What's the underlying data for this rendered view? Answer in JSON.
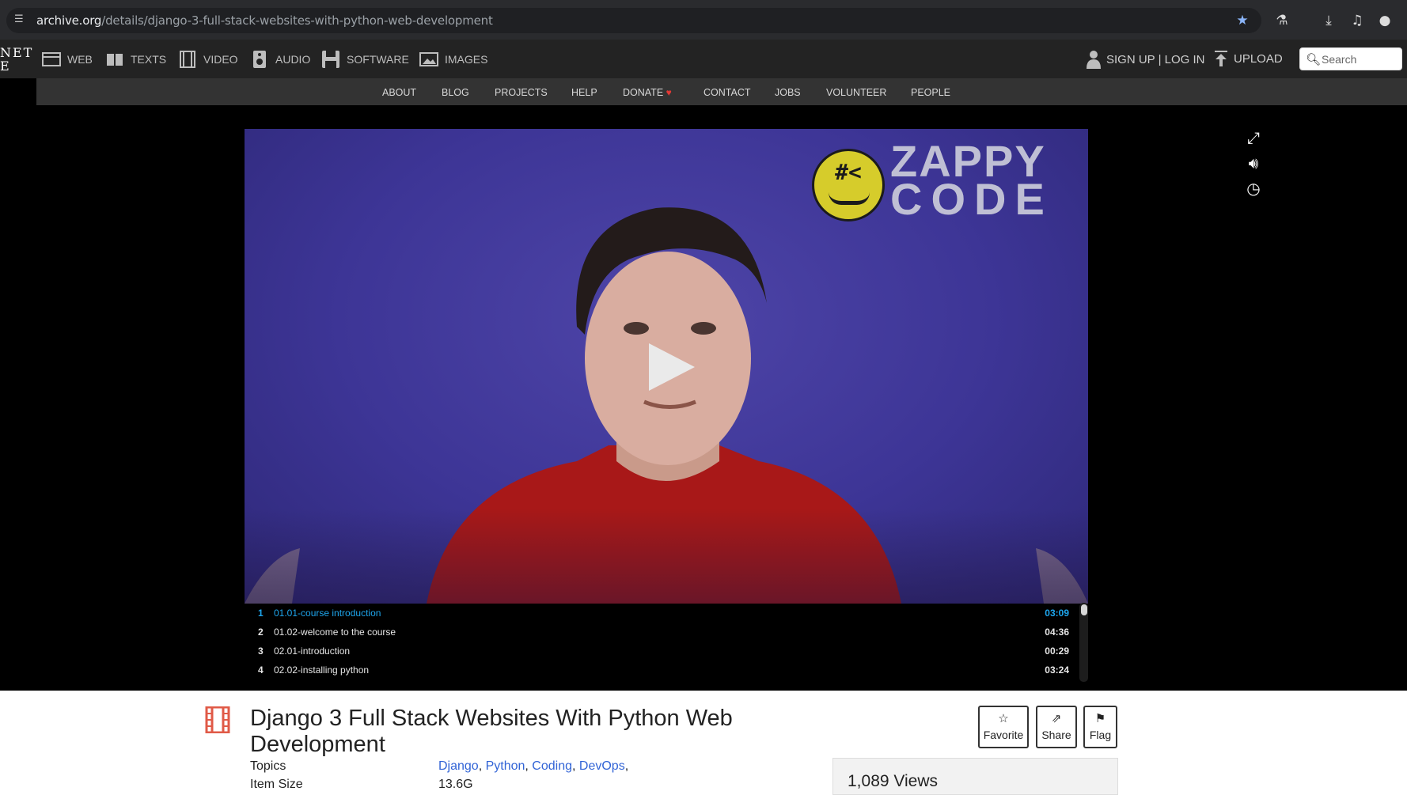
{
  "browser": {
    "url_host": "archive.org",
    "url_path": "/details/django-3-full-stack-websites-with-python-web-development",
    "icons": [
      "tune-icon",
      "bookmark-star-icon",
      "labs-flask-icon",
      "download-icon",
      "media-queue-icon",
      "profile-icon"
    ]
  },
  "ia_header": {
    "logo_line1": "NET",
    "logo_line2": "E",
    "media": [
      {
        "label": "WEB",
        "icon": "web-icon"
      },
      {
        "label": "TEXTS",
        "icon": "texts-icon"
      },
      {
        "label": "VIDEO",
        "icon": "video-icon"
      },
      {
        "label": "AUDIO",
        "icon": "audio-icon"
      },
      {
        "label": "SOFTWARE",
        "icon": "software-icon"
      },
      {
        "label": "IMAGES",
        "icon": "images-icon"
      }
    ],
    "signup_login": "SIGN UP | LOG IN",
    "upload": "UPLOAD",
    "search_placeholder": "Search"
  },
  "subnav": {
    "items": [
      "ABOUT",
      "BLOG",
      "PROJECTS",
      "HELP",
      "DONATE",
      "CONTACT",
      "JOBS",
      "VOLUNTEER",
      "PEOPLE"
    ]
  },
  "player": {
    "logo_top": "ZAPPY",
    "logo_bottom": "CODE",
    "logo_face": "#<",
    "controls": [
      "fullscreen-icon",
      "volume-icon",
      "clock-icon"
    ],
    "playlist": [
      {
        "num": "1",
        "title": "01.01-course introduction",
        "duration": "03:09",
        "active": true
      },
      {
        "num": "2",
        "title": "01.02-welcome to the course",
        "duration": "04:36",
        "active": false
      },
      {
        "num": "3",
        "title": "02.01-introduction",
        "duration": "00:29",
        "active": false
      },
      {
        "num": "4",
        "title": "02.02-installing python",
        "duration": "03:24",
        "active": false
      }
    ]
  },
  "item": {
    "title": "Django 3 Full Stack Websites With Python Web Development",
    "topics_label": "Topics",
    "topics": [
      "Django",
      "Python",
      "Coding",
      "DevOps"
    ],
    "size_label": "Item Size",
    "size_value": "13.6G",
    "actions": [
      {
        "label": "Favorite",
        "icon": "star-icon"
      },
      {
        "label": "Share",
        "icon": "share-icon"
      },
      {
        "label": "Flag",
        "icon": "flag-icon"
      }
    ],
    "views": "1,089 Views"
  },
  "colors": {
    "accent_blue": "#1ea7ef",
    "link_blue": "#3264d6",
    "heart_red": "#e53935",
    "film_icon_red": "#e05a47"
  }
}
